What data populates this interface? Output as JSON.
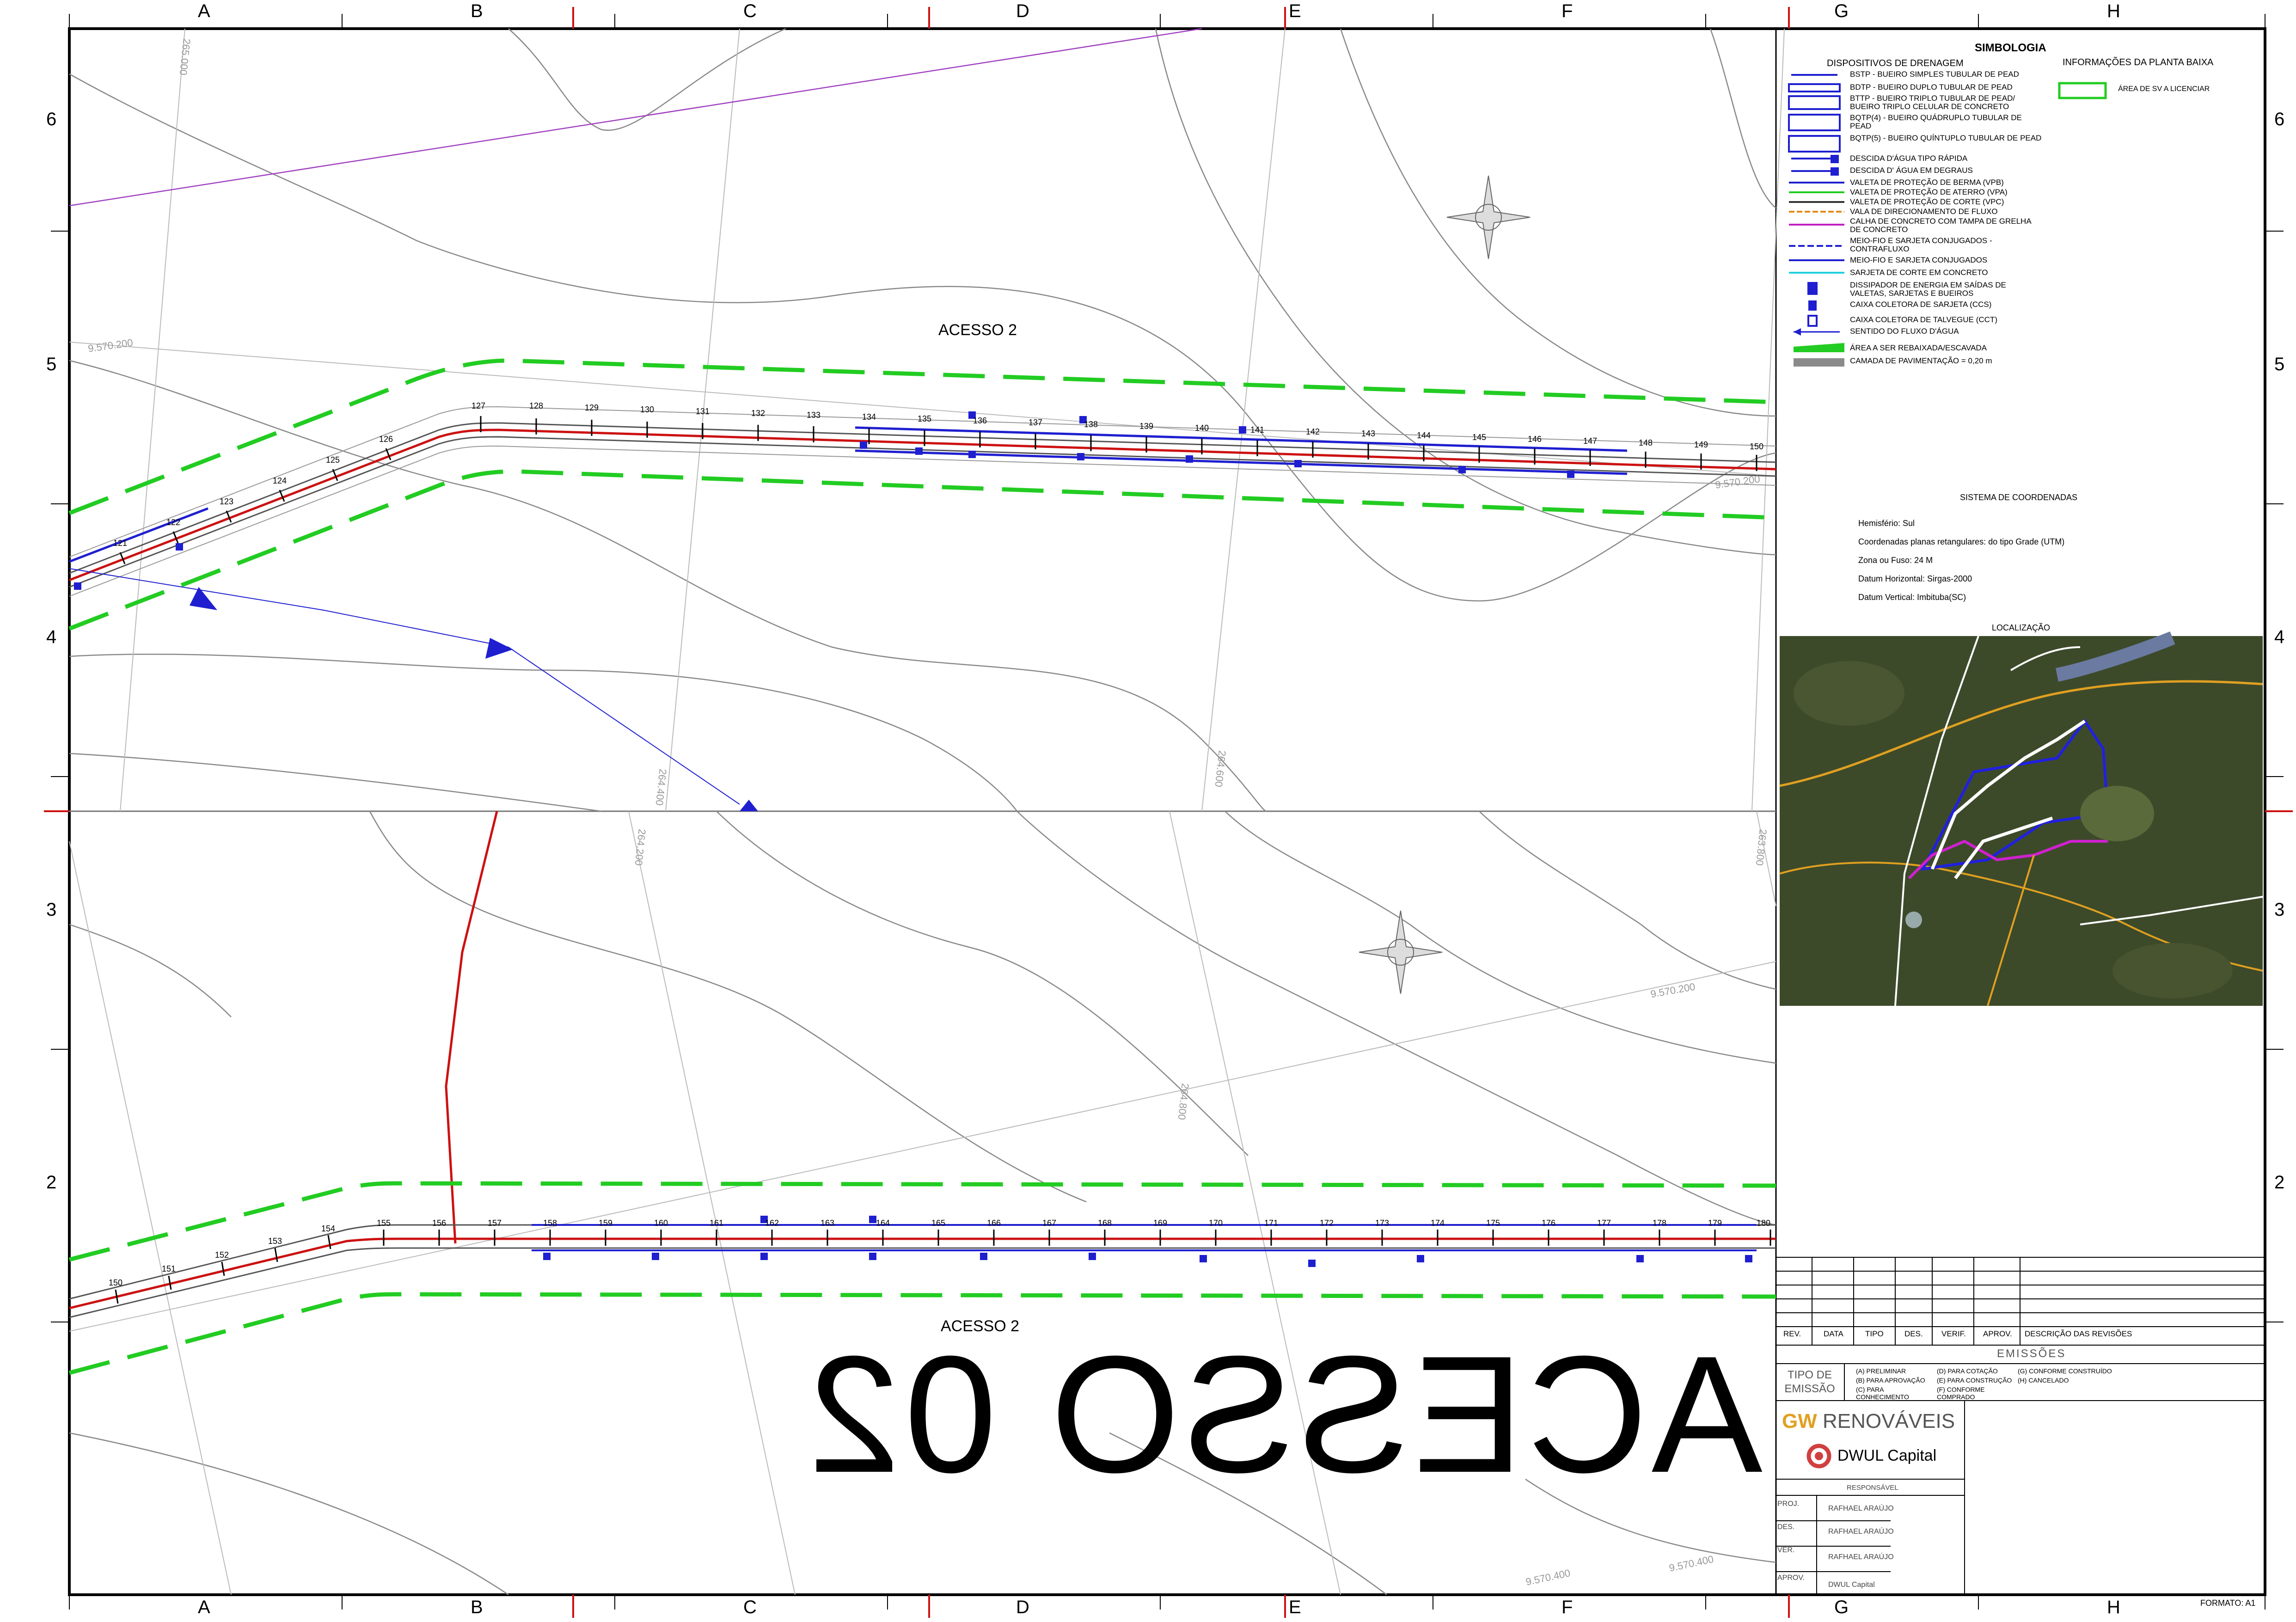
{
  "grid": {
    "columns": [
      "A",
      "B",
      "C",
      "D",
      "E",
      "F",
      "G",
      "H"
    ],
    "rows": [
      "6",
      "5",
      "4",
      "3",
      "2"
    ]
  },
  "map": {
    "upper_label": "ACESSO 2",
    "lower_label": "ACESSO 2",
    "big_flipped_text": "ACESSO 02",
    "upper_stations": [
      "127",
      "128",
      "129",
      "130",
      "131",
      "132",
      "133",
      "134",
      "135",
      "136",
      "137",
      "138",
      "139",
      "140",
      "141",
      "142",
      "143",
      "144",
      "145",
      "146",
      "147",
      "148",
      "149",
      "150",
      "121",
      "122",
      "123",
      "124",
      "125",
      "126"
    ],
    "lower_stations": [
      "150",
      "151",
      "152",
      "153",
      "154",
      "155",
      "156",
      "157",
      "158",
      "159",
      "160",
      "161",
      "162",
      "163",
      "164",
      "165",
      "166",
      "167",
      "168",
      "169",
      "170",
      "171",
      "172",
      "173",
      "174",
      "175",
      "176",
      "177",
      "178",
      "179",
      "180"
    ],
    "coord_labels": [
      "9.570.200",
      "9.570.200",
      "9.570.200",
      "9.570.400",
      "9.570.400",
      "264.600",
      "264.800",
      "265.000",
      "263.800",
      "264.200",
      "264.400"
    ]
  },
  "legend": {
    "title": "SIMBOLOGIA",
    "drainage_title": "DISPOSITIVOS DE DRENAGEM",
    "info_title": "INFORMAÇÕES DA PLANTA BAIXA",
    "info_item": "ÁREA DE SV A LICENCIAR",
    "items": [
      "BSTP - BUEIRO SIMPLES TUBULAR DE PEAD",
      "BDTP - BUEIRO DUPLO TUBULAR DE PEAD",
      "BTTP - BUEIRO TRIPLO TUBULAR DE PEAD/ BUEIRO TRIPLO CELULAR DE CONCRETO",
      "BQTP(4) - BUEIRO QUÁDRUPLO TUBULAR DE PEAD",
      "BQTP(5) - BUEIRO QUÍNTUPLO TUBULAR DE PEAD",
      "DESCIDA D'ÁGUA TIPO RÁPIDA",
      "DESCIDA D' ÁGUA EM DEGRAUS",
      "VALETA DE PROTEÇÃO DE BERMA (VPB)",
      "VALETA DE PROTEÇÃO DE ATERRO (VPA)",
      "VALETA DE PROTEÇÃO DE CORTE (VPC)",
      "VALA DE DIRECIONAMENTO DE FLUXO",
      "CALHA DE CONCRETO COM TAMPA DE GRELHA DE CONCRETO",
      "MEIO-FIO E SARJETA CONJUGADOS - CONTRAFLUXO",
      "MEIO-FIO E SARJETA CONJUGADOS",
      "SARJETA DE CORTE EM CONCRETO",
      "DISSIPADOR DE ENERGIA EM SAÍDAS DE VALETAS, SARJETAS E BUEIROS",
      "CAIXA COLETORA DE SARJETA (CCS)",
      "CAIXA COLETORA DE TALVEGUE (CCT)",
      "SENTIDO DO FLUXO D'ÁGUA",
      "ÁREA A SER REBAIXADA/ESCAVADA",
      "CAMADA DE PAVIMENTAÇÃO = 0,20 m"
    ],
    "colors": {
      "blue": "#1f1fd0",
      "green": "#22cc22",
      "red": "#cc1111",
      "orange": "#e08a1e",
      "magenta": "#c020c0",
      "cyan": "#20d0e0",
      "gray": "#8a8a8a"
    }
  },
  "coord_system": {
    "title": "SISTEMA DE COORDENADAS",
    "lines": [
      "Hemisfério: Sul",
      "Coordenadas planas retangulares: do tipo Grade (UTM)",
      "Zona ou Fuso: 24 M",
      "Datum Horizontal: Sirgas-2000",
      "Datum Vertical: Imbituba(SC)"
    ]
  },
  "location": {
    "title": "LOCALIZAÇÃO"
  },
  "title_block": {
    "rev_headers": [
      "REV.",
      "DATA",
      "TIPO",
      "DES.",
      "VERIF.",
      "APROV.",
      "DESCRIÇÃO DAS REVISÕES"
    ],
    "emissoes": "EMISSÕES",
    "tipo_emissao": "TIPO DE EMISSÃO",
    "emission_options": [
      "(A) PRELIMINAR",
      "(D) PARA COTAÇÃO",
      "(G) CONFORME CONSTRUÍDO",
      "(B) PARA APROVAÇÃO",
      "(E) PARA CONSTRUÇÃO",
      "(H) CANCELADO",
      "(C) PARA CONHECIMENTO",
      "(F) CONFORME COMPRADO",
      ""
    ],
    "company1_gw": "GW",
    "company1_rest": " RENOVÁVEIS",
    "company2": "DWUL Capital",
    "responsavel": "RESPONSÁVEL",
    "roles": [
      {
        "role": "PROJ.",
        "name": "RAFHAEL ARAÚJO"
      },
      {
        "role": "DES.",
        "name": "RAFHAEL ARAÚJO"
      },
      {
        "role": "VER.",
        "name": "RAFHAEL ARAÚJO"
      },
      {
        "role": "APROV.",
        "name": "DWUL Capital"
      }
    ],
    "formato": "FORMATO: A1"
  }
}
